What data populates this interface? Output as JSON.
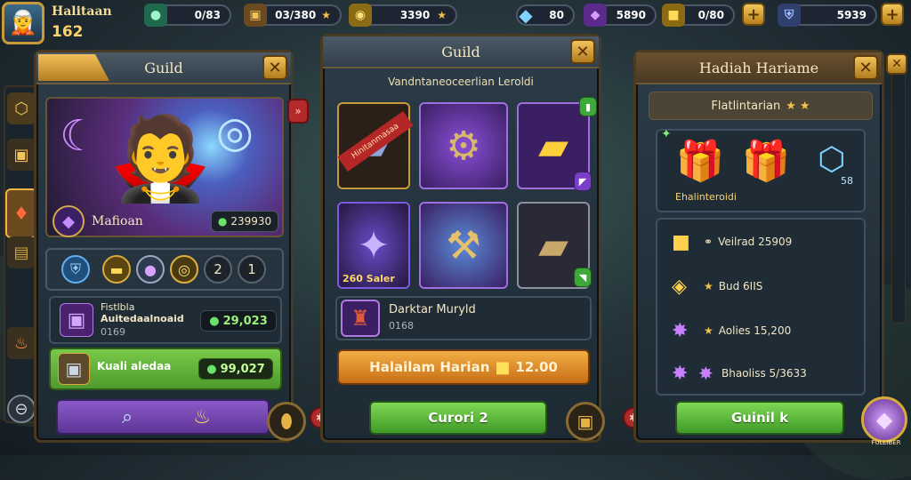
{
  "player": {
    "name": "Halitaan",
    "level": "162"
  },
  "resources": [
    {
      "icon": "green-gem-icon",
      "value": "0/83"
    },
    {
      "icon": "chest-icon",
      "value": "03/380"
    },
    {
      "icon": "gold-coin-icon",
      "value": "3390"
    },
    {
      "icon": "blue-crystal-icon",
      "value": "80"
    },
    {
      "icon": "purple-gem-icon",
      "value": "5890"
    },
    {
      "icon": "gold-cube-icon",
      "value": "0/80"
    },
    {
      "icon": "shield-icon",
      "value": "5939"
    }
  ],
  "left_panel": {
    "title": "Guild",
    "hero_name": "Mafioan",
    "hero_power": "239930",
    "badge_counts": [
      "2",
      "1"
    ],
    "offer1": {
      "title": "Fistlbla",
      "subtitle": "Auitedaalnoaid",
      "extra": "0169",
      "price": "29,023"
    },
    "offer2": {
      "title": "Kuali aledaa",
      "price": "99,027"
    }
  },
  "center_panel": {
    "title": "Guild",
    "subtitle": "Vandntaneoceerlian Leroldi",
    "ribbon": "Hinitanmasaa",
    "sale_label": "260 Saler",
    "item_name": "Darktar Muryld",
    "item_code": "0168",
    "buy_label": "Halailam Harian",
    "buy_price": "12.00",
    "green_button": "Curori 2"
  },
  "right_panel": {
    "title": "Hadiah Hariame",
    "subheader": "Flatlintarian",
    "reward_caption": "Ehalinteroidi",
    "reward_count": "58",
    "list": [
      {
        "text": "Veilrad 25909"
      },
      {
        "text": "Bud 6IIS"
      },
      {
        "text": "Aolies 15,200"
      },
      {
        "text": "Bhaoliss 5/3633"
      }
    ],
    "green_button": "Guinil k"
  },
  "corner_label": "FULLIBER"
}
